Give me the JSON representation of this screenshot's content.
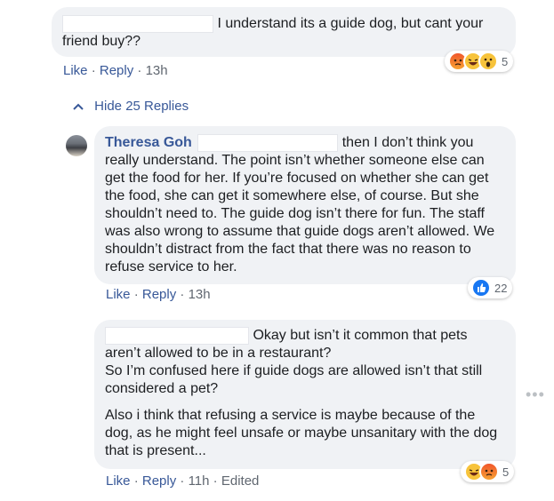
{
  "comment1": {
    "text": "I understand its a guide dog, but cant your friend buy??",
    "actions": {
      "like": "Like",
      "reply": "Reply",
      "time": "13h"
    },
    "reactions": {
      "icons": [
        "angry-icon",
        "haha-icon",
        "wow-icon"
      ],
      "count": "5"
    }
  },
  "toggle": {
    "label": "Hide 25 Replies"
  },
  "comment2": {
    "author": "Theresa Goh",
    "text": "then I don’t think you really understand. The point isn’t whether someone else can get the food for her. If you’re focused on whether she can get the food, she can get it somewhere else, of course. But she shouldn’t need to. The guide dog isn’t there for fun. The staff was also wrong to assume that guide dogs aren’t allowed. We shouldn’t distract from the fact that there was no reason to refuse service to her.",
    "actions": {
      "like": "Like",
      "reply": "Reply",
      "time": "13h"
    },
    "reactions": {
      "icons": [
        "like-icon"
      ],
      "count": "22"
    }
  },
  "comment3": {
    "para1": "Okay but isn’t it common that pets aren’t allowed to be in a restaurant?",
    "para2": "So I’m confused here if guide dogs are allowed isn’t that still considered a pet?",
    "para3": "Also i think that refusing a service is maybe because of the dog, as he might feel unsafe or maybe unsanitary with the dog that is present...",
    "actions": {
      "like": "Like",
      "reply": "Reply",
      "time": "11h",
      "edited": "Edited"
    },
    "reactions": {
      "icons": [
        "haha-icon",
        "angry-icon"
      ],
      "count": "5"
    }
  },
  "menu": {
    "icon": "more-options-icon"
  }
}
